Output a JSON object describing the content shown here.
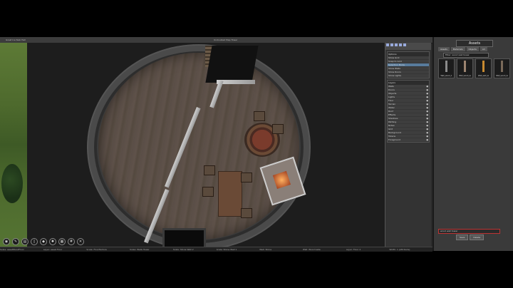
{
  "window": {
    "left_tab": "Great Ice Slab Hall",
    "center_tab": "Undoubled Map Tower"
  },
  "toolbar_bottom": {
    "icons": [
      "select-icon",
      "brush-icon",
      "wall-icon",
      "door-icon",
      "object-icon",
      "light-icon",
      "texture-icon",
      "grid-icon",
      "close-icon"
    ]
  },
  "status": [
    "Scale: assetWoodFloor",
    "Layer: asset Floor",
    "Scale: FloorTexture",
    "Scale: Walls Tower",
    "Scale: Stone Wall 2",
    "Scale: Stone Wall 1",
    "Wall: Stone",
    "Wall: Wood Gate",
    "Layer: Floor 2",
    "Width: 1 (Attribute)"
  ],
  "side_panel": {
    "options_header": "Options",
    "options": [
      "Show Grid",
      "Snap to Grid",
      "Selection Mode",
      "Show Walls",
      "Show Doors",
      "Show Lights"
    ],
    "layers_header": "Layers",
    "layers": [
      "Walls",
      "Doors",
      "Objects",
      "Lights",
      "Floor",
      "Terrain",
      "Water",
      "Roof",
      "Effects",
      "Shadows",
      "Pathing",
      "Notes",
      "Grid",
      "Background",
      "Tokens",
      "Foreground"
    ]
  },
  "assets": {
    "title": "Assets",
    "tabs": [
      "Assets",
      "Materials",
      "Objects",
      "All"
    ],
    "filter": "Filter: wood wall tower",
    "items": [
      {
        "label": "Wall_wood_1",
        "color": "#8a8a8a"
      },
      {
        "label": "Wall_wood_la",
        "color": "#9c8470"
      },
      {
        "label": "Wall_wall_la",
        "color": "#c88a30"
      },
      {
        "label": "Wall_wood_la",
        "color": "#7a6a5a"
      }
    ],
    "input_value": "wood wall tower",
    "buttons": [
      "Save",
      "Delete"
    ]
  }
}
